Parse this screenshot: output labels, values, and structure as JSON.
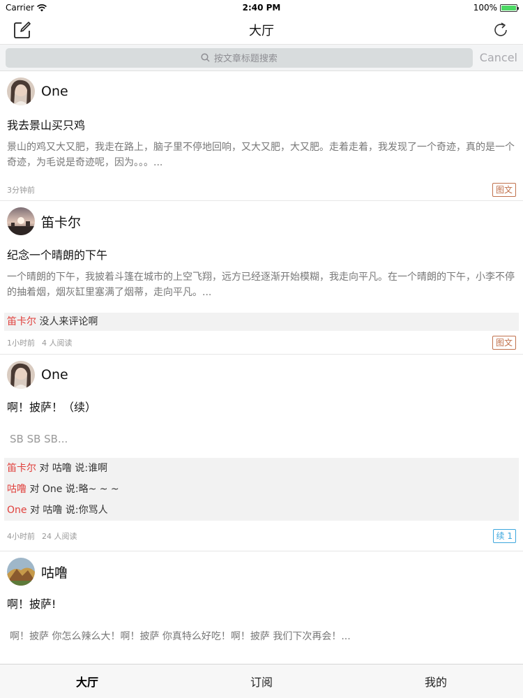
{
  "status_bar": {
    "carrier": "Carrier",
    "time": "2:40 PM",
    "battery": "100%"
  },
  "nav": {
    "title": "大厅",
    "left_icon": "compose-icon",
    "right_icon": "refresh-icon"
  },
  "search": {
    "placeholder": "按文章标题搜索",
    "cancel": "Cancel"
  },
  "posts": [
    {
      "author": "One",
      "title": "我去景山买只鸡",
      "excerpt": "景山的鸡又大又肥，我走在路上，脑子里不停地回响，又大又肥，大又肥。走着走着，我发现了一个奇迹，真的是一个奇迹，为毛说是奇迹呢，因为。。。...",
      "time": "3分钟前",
      "tag": "图文"
    },
    {
      "author": "笛卡尔",
      "title": "纪念一个晴朗的下午",
      "excerpt": "一个晴朗的下午，我披着斗篷在城市的上空飞翔，远方已经逐渐开始模糊，我走向平凡。在一个晴朗的下午，小李不停的抽着烟，烟灰缸里塞满了烟蒂，走向平凡。...",
      "comments": [
        {
          "user": "笛卡尔",
          "text": " 没人来评论啊"
        }
      ],
      "time": "1小时前",
      "reads": "4 人阅读",
      "tag": "图文"
    },
    {
      "author": "One",
      "title": "啊！披萨！（续）",
      "excerpt": "SB SB SB...",
      "comments": [
        {
          "user": "笛卡尔",
          "text": " 对 咕噜 说:谁啊"
        },
        {
          "user": "咕噜",
          "text": " 对 One 说:略~ ~ ~"
        },
        {
          "user": "One",
          "text": " 对 咕噜 说:你骂人"
        }
      ],
      "time": "4小时前",
      "reads": "24 人阅读",
      "tag": "续 1"
    },
    {
      "author": "咕噜",
      "title": "啊！披萨!",
      "excerpt": "啊！披萨 你怎么辣么大！啊！披萨 你真特么好吃！啊！披萨 我们下次再会！..."
    }
  ],
  "tabs": [
    {
      "label": "大厅"
    },
    {
      "label": "订阅"
    },
    {
      "label": "我的"
    }
  ],
  "colors": {
    "comment_user": "#e0403c",
    "tag_brown": "#c0714c",
    "tag_blue": "#3ba6dd",
    "battery": "#4cd964"
  }
}
